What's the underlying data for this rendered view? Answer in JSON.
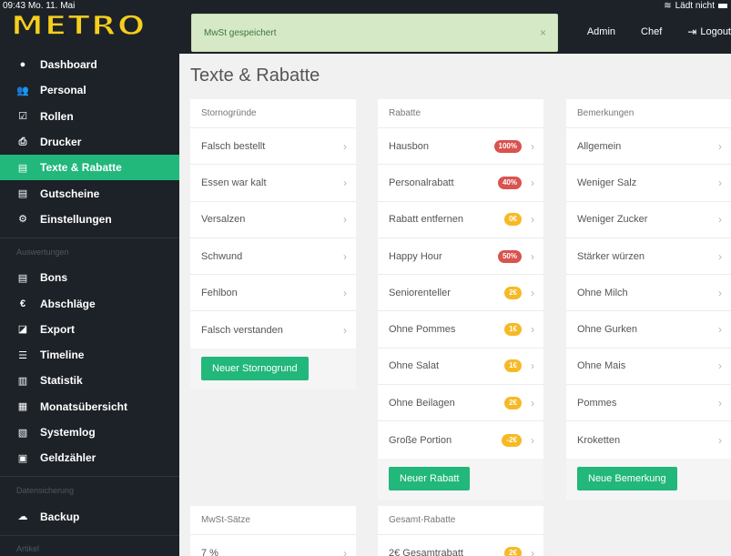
{
  "status_bar": {
    "time": "09:43",
    "date": "Mo. 11. Mai",
    "charging": "Lädt nicht"
  },
  "logo": "METRO",
  "toast": {
    "message": "MwSt gespeichert",
    "close": "×"
  },
  "header_links": {
    "admin": "Admin",
    "chef": "Chef",
    "logout": "Logout"
  },
  "sidebar": {
    "items": [
      {
        "label": "Dashboard",
        "icon": "dashboard-icon",
        "glyph": "●"
      },
      {
        "label": "Personal",
        "icon": "users-icon",
        "glyph": "👥"
      },
      {
        "label": "Rollen",
        "icon": "check-square-icon",
        "glyph": "☑"
      },
      {
        "label": "Drucker",
        "icon": "printer-icon",
        "glyph": "⎙"
      },
      {
        "label": "Texte & Rabatte",
        "icon": "file-icon",
        "glyph": "▤",
        "active": true
      },
      {
        "label": "Gutscheine",
        "icon": "file-icon",
        "glyph": "▤"
      },
      {
        "label": "Einstellungen",
        "icon": "cogs-icon",
        "glyph": "⚙"
      }
    ],
    "section_evaluations": "Auswertungen",
    "evaluation_items": [
      {
        "label": "Bons",
        "icon": "file-icon",
        "glyph": "▤"
      },
      {
        "label": "Abschläge",
        "icon": "euro-icon",
        "glyph": "€"
      },
      {
        "label": "Export",
        "icon": "export-icon",
        "glyph": "◪"
      },
      {
        "label": "Timeline",
        "icon": "list-icon",
        "glyph": "☰"
      },
      {
        "label": "Statistik",
        "icon": "bar-chart-icon",
        "glyph": "▥"
      },
      {
        "label": "Monatsübersicht",
        "icon": "calendar-icon",
        "glyph": "▦"
      },
      {
        "label": "Systemlog",
        "icon": "document-icon",
        "glyph": "▧"
      },
      {
        "label": "Geldzähler",
        "icon": "money-icon",
        "glyph": "▣"
      }
    ],
    "section_backup": "Datensicherung",
    "backup_items": [
      {
        "label": "Backup",
        "icon": "cloud-upload-icon",
        "glyph": "☁"
      }
    ],
    "section_articles": "Artikel"
  },
  "page_title": "Texte & Rabatte",
  "storno": {
    "title": "Stornogründe",
    "items": [
      "Falsch bestellt",
      "Essen war kalt",
      "Versalzen",
      "Schwund",
      "Fehlbon",
      "Falsch verstanden"
    ],
    "button": "Neuer Stornogrund"
  },
  "rabatte": {
    "title": "Rabatte",
    "items": [
      {
        "label": "Hausbon",
        "badge": "100%",
        "color": "red"
      },
      {
        "label": "Personalrabatt",
        "badge": "40%",
        "color": "red"
      },
      {
        "label": "Rabatt entfernen",
        "badge": "0€",
        "color": "yellow"
      },
      {
        "label": "Happy Hour",
        "badge": "50%",
        "color": "red"
      },
      {
        "label": "Seniorenteller",
        "badge": "2€",
        "color": "yellow"
      },
      {
        "label": "Ohne Pommes",
        "badge": "1€",
        "color": "yellow"
      },
      {
        "label": "Ohne Salat",
        "badge": "1€",
        "color": "yellow"
      },
      {
        "label": "Ohne Beilagen",
        "badge": "2€",
        "color": "yellow"
      },
      {
        "label": "Große Portion",
        "badge": "-2€",
        "color": "yellow"
      }
    ],
    "button": "Neuer Rabatt"
  },
  "bemerkungen": {
    "title": "Bemerkungen",
    "items": [
      "Allgemein",
      "Weniger Salz",
      "Weniger Zucker",
      "Stärker würzen",
      "Ohne Milch",
      "Ohne Gurken",
      "Ohne Mais",
      "Pommes",
      "Kroketten"
    ],
    "button": "Neue Bemerkung"
  },
  "mwst": {
    "title": "MwSt-Sätze",
    "items": [
      "7 %"
    ]
  },
  "gesamt": {
    "title": "Gesamt-Rabatte",
    "items": [
      {
        "label": "2€ Gesamtrabatt",
        "badge": "2€",
        "color": "yellow"
      }
    ]
  },
  "colors": {
    "sidebar_bg": "#1d2228",
    "accent_green": "#22b77b",
    "logo_yellow": "#f5cf1c",
    "badge_red": "#d9534f",
    "badge_yellow": "#f6b926",
    "toast_bg": "#d6e9c6"
  }
}
